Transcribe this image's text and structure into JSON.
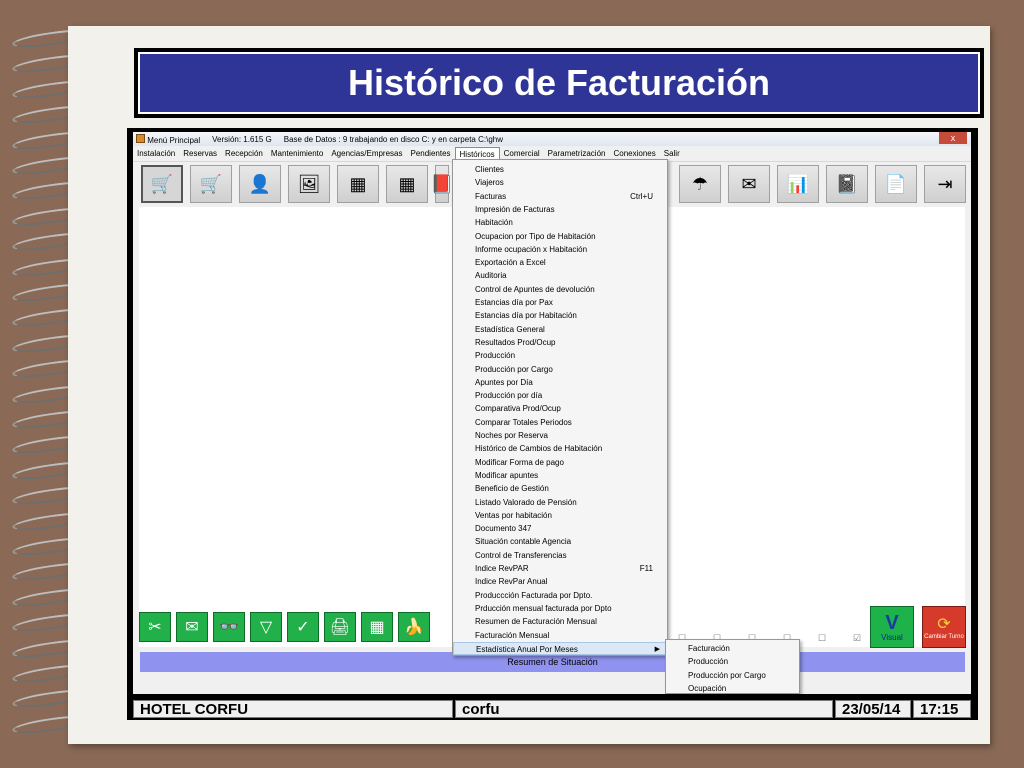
{
  "slide": {
    "title": "Histórico de Facturación"
  },
  "window": {
    "title_app": "Menú Principal",
    "title_version": "Versión: 1.615 G",
    "title_db": "Base de Datos : 9   trabajando en disco C: y en carpeta C:\\ghw",
    "close_glyph": "x"
  },
  "menubar": {
    "items": [
      "Instalación",
      "Reservas",
      "Recepción",
      "Mantenimiento",
      "Agencias/Empresas",
      "Pendientes",
      "Históricos",
      "Comercial",
      "Parametrización",
      "Conexiones",
      "Salir"
    ]
  },
  "dropdown": {
    "items": [
      {
        "label": "Clientes",
        "shortcut": ""
      },
      {
        "label": "Viajeros",
        "shortcut": ""
      },
      {
        "label": "Facturas",
        "shortcut": "Ctrl+U"
      },
      {
        "label": "Impresión de Facturas",
        "shortcut": ""
      },
      {
        "label": "Habitación",
        "shortcut": ""
      },
      {
        "label": "Ocupacion por Tipo de Habitación",
        "shortcut": ""
      },
      {
        "label": "Informe ocupación x Habitación",
        "shortcut": ""
      },
      {
        "label": "Exportación a Excel",
        "shortcut": ""
      },
      {
        "label": "Auditoria",
        "shortcut": ""
      },
      {
        "label": "Control de Apuntes de devolución",
        "shortcut": ""
      },
      {
        "label": "Estancias día por Pax",
        "shortcut": ""
      },
      {
        "label": "Estancias día por Habitación",
        "shortcut": ""
      },
      {
        "label": "Estadística General",
        "shortcut": ""
      },
      {
        "label": "Resultados Prod/Ocup",
        "shortcut": ""
      },
      {
        "label": "Producción",
        "shortcut": ""
      },
      {
        "label": "Producción por Cargo",
        "shortcut": ""
      },
      {
        "label": "Apuntes por Día",
        "shortcut": ""
      },
      {
        "label": "Producción por día",
        "shortcut": ""
      },
      {
        "label": "Comparativa Prod/Ocup",
        "shortcut": ""
      },
      {
        "label": "Comparar Totales Periodos",
        "shortcut": ""
      },
      {
        "label": "Noches por Reserva",
        "shortcut": ""
      },
      {
        "label": "Histórico de Cambios de Habitación",
        "shortcut": ""
      },
      {
        "label": "Modificar Forma de pago",
        "shortcut": ""
      },
      {
        "label": "Modificar apuntes",
        "shortcut": ""
      },
      {
        "label": "Beneficio de Gestión",
        "shortcut": ""
      },
      {
        "label": "Listado Valorado de Pensión",
        "shortcut": ""
      },
      {
        "label": "Ventas por habitación",
        "shortcut": ""
      },
      {
        "label": "Documento 347",
        "shortcut": ""
      },
      {
        "label": "Situación contable Agencia",
        "shortcut": ""
      },
      {
        "label": "Control de Transferencias",
        "shortcut": ""
      },
      {
        "label": "Indice RevPAR",
        "shortcut": "F11"
      },
      {
        "label": "Indice RevPar Anual",
        "shortcut": ""
      },
      {
        "label": "Produccción Facturada por Dpto.",
        "shortcut": ""
      },
      {
        "label": "Prducción mensual facturada por Dpto",
        "shortcut": ""
      },
      {
        "label": "Resumen de Facturación  Mensual",
        "shortcut": ""
      },
      {
        "label": "Facturación Mensual",
        "shortcut": ""
      },
      {
        "label": "Estadística Anual Por Meses",
        "shortcut": ""
      }
    ],
    "submenu_arrow": "▶"
  },
  "submenu": {
    "items": [
      "Facturación",
      "Producción",
      "Producción por Cargo",
      "Ocupación"
    ]
  },
  "toolbar": {
    "icons": [
      "cart-icon",
      "cart-icon",
      "person-icon",
      "image-icon",
      "grid-icon",
      "grid-icon",
      "book-icon",
      "umbrella-icon",
      "envelope-icon",
      "bar-chart-icon",
      "notebook-icon",
      "documents-icon",
      "exit-door-icon"
    ],
    "glyphs": [
      "🛒",
      "🛒",
      "👤",
      "🖼",
      "▦",
      "▦",
      "📕",
      "☂",
      "✉",
      "📊",
      "📓",
      "📄",
      "⇥"
    ]
  },
  "bottom_buttons": {
    "icons": [
      "scissors-icon",
      "envelope-icon",
      "binoculars-icon",
      "triangle-down-icon",
      "checkmark-icon",
      "printer-icon",
      "grid-icon",
      "banana-icon"
    ],
    "glyphs": [
      "✂",
      "✉",
      "👓",
      "▽",
      "✓",
      "🖨",
      "▦",
      "🍌"
    ]
  },
  "visual_button": {
    "glyph": "V",
    "label": "Visual"
  },
  "cambiar_button": {
    "glyph": "⟳",
    "label": "Cambiar Turno"
  },
  "checks": {
    "glyphs": [
      "☐",
      "☐",
      "☐",
      "☐",
      "☐",
      "☑"
    ]
  },
  "resumen_bar": {
    "label": "Resumen de Situación"
  },
  "status": {
    "hotel": "HOTEL CORFU",
    "user": "corfu",
    "date": "23/05/14",
    "time": "17:15"
  },
  "colors": {
    "title_bg": "#2f3596",
    "resumen_bg": "#8f92ef",
    "green_button": "#22b04a",
    "red_button": "#d63a2a"
  }
}
